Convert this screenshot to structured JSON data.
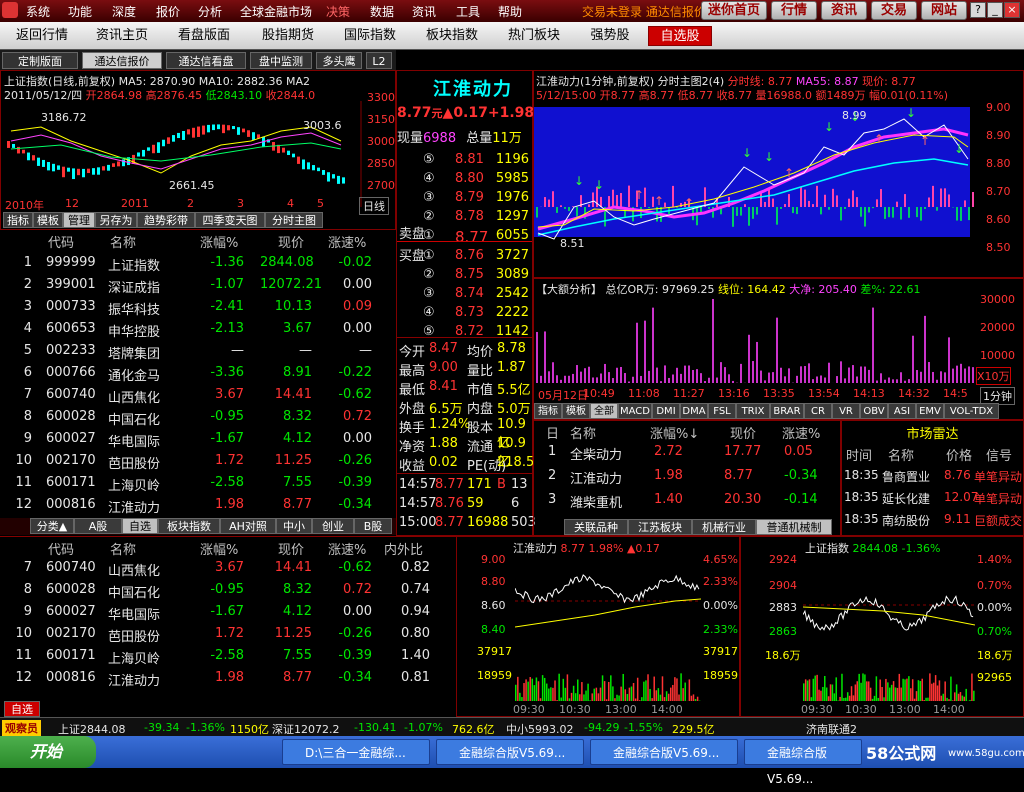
{
  "menubar": {
    "items": [
      "系统",
      "功能",
      "深度",
      "报价",
      "分析",
      "全球金融市场",
      "决策",
      "数据",
      "资讯",
      "工具",
      "帮助"
    ],
    "promo": "交易未登录 通达信报价",
    "buttons": [
      "迷你首页",
      "行情",
      "资讯",
      "交易",
      "网站"
    ]
  },
  "nav": {
    "items": [
      "返回行情",
      "资讯主页",
      "看盘版面",
      "股指期货",
      "国际指数",
      "板块指数",
      "热门板块",
      "强势股",
      "自选股"
    ],
    "active": "自选股"
  },
  "subtabs": [
    "定制版面",
    "通达信报价",
    "通达信看盘",
    "盘中监测",
    "多头鹰",
    "L2"
  ],
  "index_chart": {
    "title": "上证指数(日线,前复权) MA5: 2870.90 MA10: 2882.36 MA2",
    "date_line": "2011/05/12/四",
    "open": "开2864.98",
    "high": "高2876.45",
    "low": "低2843.10",
    "close": "收2844.0",
    "yticks": [
      "3300",
      "3150",
      "3000",
      "2850",
      "2700"
    ],
    "labels": {
      "p1": "3186.72",
      "p2": "3003.6",
      "p3": "2661.45"
    },
    "xlabels": [
      "2010年",
      "12",
      "2011",
      "2",
      "3",
      "4",
      "5"
    ],
    "mode": "日线",
    "tabs": [
      "指标",
      "模板",
      "管理",
      "另存为",
      "趋势彩带",
      "四季变天图",
      "分时主图"
    ]
  },
  "stock_table": {
    "headers": [
      "代码",
      "名称",
      "涨幅%",
      "现价",
      "涨速%"
    ],
    "rows": [
      [
        "1",
        "999999",
        "上证指数",
        "-1.36",
        "2844.08",
        "-0.02"
      ],
      [
        "2",
        "399001",
        "深证成指",
        "-1.07",
        "12072.21",
        "0.00"
      ],
      [
        "3",
        "000733",
        "振华科技",
        "-2.41",
        "10.13",
        "0.09"
      ],
      [
        "4",
        "600653",
        "申华控股",
        "-2.13",
        "3.67",
        "0.00"
      ],
      [
        "5",
        "002233",
        "塔牌集团",
        "—",
        "—",
        "—"
      ],
      [
        "6",
        "000766",
        "通化金马",
        "-3.36",
        "8.91",
        "-0.22"
      ],
      [
        "7",
        "600740",
        "山西焦化",
        "3.67",
        "14.41",
        "-0.62"
      ],
      [
        "8",
        "600028",
        "中国石化",
        "-0.95",
        "8.32",
        "0.72"
      ],
      [
        "9",
        "600027",
        "华电国际",
        "-1.67",
        "4.12",
        "0.00"
      ],
      [
        "10",
        "002170",
        "芭田股份",
        "1.72",
        "11.25",
        "-0.26"
      ],
      [
        "11",
        "600171",
        "上海贝岭",
        "-2.58",
        "7.55",
        "-0.39"
      ],
      [
        "12",
        "000816",
        "江淮动力",
        "1.98",
        "8.77",
        "-0.34"
      ]
    ],
    "tabs": [
      "分类▲",
      "A股",
      "自选",
      "板块指数",
      "AH对照",
      "中小",
      "创业",
      "B股"
    ]
  },
  "quote": {
    "name": "江淮动力",
    "price": "8.77",
    "unit": "元",
    "change": "▲0.17",
    "pct": "+1.98",
    "now_vol_label": "现量",
    "now_vol": "6988",
    "total_label": "总量",
    "total": "11万",
    "sell": [
      [
        "⑤",
        "8.81",
        "1196"
      ],
      [
        "④",
        "8.80",
        "5985"
      ],
      [
        "③",
        "8.79",
        "1976"
      ],
      [
        "②",
        "8.78",
        "1297"
      ],
      [
        "①",
        "8.77",
        "6055"
      ]
    ],
    "sell_label": "卖盘",
    "buy_label": "买盘",
    "buy": [
      [
        "①",
        "8.76",
        "3727"
      ],
      [
        "②",
        "8.75",
        "3089"
      ],
      [
        "③",
        "8.74",
        "2542"
      ],
      [
        "④",
        "8.73",
        "2222"
      ],
      [
        "⑤",
        "8.72",
        "1142"
      ]
    ],
    "stats": [
      [
        "今开",
        "8.47",
        "均价",
        "8.78"
      ],
      [
        "最高",
        "9.00",
        "量比",
        "1.87"
      ],
      [
        "最低",
        "8.41",
        "市值",
        "5.5亿"
      ],
      [
        "外盘",
        "6.5万",
        "内盘",
        "5.0万"
      ],
      [
        "换手",
        "1.24%",
        "股本",
        "10.9亿"
      ],
      [
        "净资",
        "1.88",
        "流通",
        "10.9亿"
      ],
      [
        "收益",
        "0.02",
        "PE(动)",
        "218.5"
      ]
    ],
    "ticks": [
      [
        "14:57",
        "8.77",
        "171",
        "B",
        "13"
      ],
      [
        "14:57",
        "8.76",
        "59",
        "",
        "6"
      ],
      [
        "15:00",
        "8.77",
        "16988",
        "",
        "503"
      ]
    ]
  },
  "intraday": {
    "title": "江淮动力(1分钟,前复权) 分时主图2(4)",
    "ma1": "分时线: 8.77",
    "ma2": "MA55: 8.87",
    "now": "现价: 8.77",
    "line2": "5/12/15:00 开8.77 高8.77 低8.77 收8.77 量16988.0 额1489万 幅0.01(0.11%)",
    "yticks": [
      "9.00",
      "8.90",
      "8.80",
      "8.70",
      "8.60",
      "8.50"
    ],
    "p_hi": "8.99",
    "p_lo": "8.51"
  },
  "fund": {
    "title": "【大额分析】",
    "v1": "总亿OR万: 97969.25",
    "v2": "线位: 164.42",
    "v3": "大净: 205.40",
    "v4": "差%: 22.61",
    "yticks": [
      "30000",
      "20000",
      "10000"
    ],
    "unit": "X10万",
    "xlabels": [
      "05月12日",
      "10:49",
      "11:08",
      "11:27",
      "13:16",
      "13:35",
      "13:54",
      "14:13",
      "14:32",
      "14:5"
    ],
    "period": "1分钟",
    "tabs": [
      "指标",
      "模板",
      "全部",
      "MACD",
      "DMI",
      "DMA",
      "FSL",
      "TRIX",
      "BRAR",
      "CR",
      "VR",
      "OBV",
      "ASI",
      "EMV",
      "VOL-TDX"
    ]
  },
  "sector": {
    "headers": [
      "日",
      "名称",
      "涨幅%↓",
      "现价",
      "涨速%"
    ],
    "rows": [
      [
        "1",
        "全柴动力",
        "2.72",
        "17.77",
        "0.05"
      ],
      [
        "2",
        "江淮动力",
        "1.98",
        "8.77",
        "-0.34"
      ],
      [
        "3",
        "潍柴重机",
        "1.40",
        "20.30",
        "-0.14"
      ]
    ],
    "tabs": [
      "关联品种",
      "江苏板块",
      "机械行业",
      "普通机械制"
    ]
  },
  "radar": {
    "title": "市场雷达",
    "headers": [
      "时间",
      "名称",
      "价格",
      "信号"
    ],
    "rows": [
      [
        "18:35",
        "鲁商置业",
        "8.76",
        "单笔异动"
      ],
      [
        "18:35",
        "延长化建",
        "12.07",
        "单笔异动"
      ],
      [
        "18:35",
        "南纺股份",
        "9.11",
        "巨额成交"
      ]
    ]
  },
  "bottom_table": {
    "headers": [
      "代码",
      "名称",
      "涨幅%",
      "现价",
      "涨速%",
      "内外比"
    ],
    "rows": [
      [
        "7",
        "600740",
        "山西焦化",
        "3.67",
        "14.41",
        "-0.62",
        "0.82"
      ],
      [
        "8",
        "600028",
        "中国石化",
        "-0.95",
        "8.32",
        "0.72",
        "0.74"
      ],
      [
        "9",
        "600027",
        "华电国际",
        "-1.67",
        "4.12",
        "0.00",
        "0.94"
      ],
      [
        "10",
        "002170",
        "芭田股份",
        "1.72",
        "11.25",
        "-0.26",
        "0.80"
      ],
      [
        "11",
        "600171",
        "上海贝岭",
        "-2.58",
        "7.55",
        "-0.39",
        "1.40"
      ],
      [
        "12",
        "000816",
        "江淮动力",
        "1.98",
        "8.77",
        "-0.34",
        "0.81"
      ]
    ],
    "tab": "自选"
  },
  "mini1": {
    "title": "江淮动力",
    "price": "8.77",
    "pct": "1.98%",
    "chg": "▲0.17",
    "yl": [
      "9.00",
      "8.80",
      "8.60",
      "8.40",
      "37917",
      "18959"
    ],
    "yr": [
      "4.65%",
      "2.33%",
      "0.00%",
      "2.33%",
      "37917",
      "18959"
    ],
    "xl": [
      "09:30",
      "10:30",
      "13:00",
      "14:00"
    ]
  },
  "mini2": {
    "title": "上证指数",
    "price": "2844.08",
    "pct": "-1.36%",
    "yl": [
      "2924",
      "2904",
      "2883",
      "2863",
      "18.6万"
    ],
    "yr": [
      "1.40%",
      "0.70%",
      "0.00%",
      "0.70%",
      "18.6万",
      "92965"
    ],
    "xl": [
      "09:30",
      "10:30",
      "13:00",
      "14:00"
    ]
  },
  "status": {
    "label": "观察员",
    "sh": "上证2844.08",
    "sh2": "-39.34",
    "sh3": "-1.36%",
    "sh4": "1150亿",
    "sz": "深证12072.2",
    "sz2": "-130.41",
    "sz3": "-1.07%",
    "sz4": "762.6亿",
    "zx": "中小5993.02",
    "zx2": "-94.29",
    "zx3": "-1.55%",
    "zx4": "229.5亿",
    "conn": "济南联通2"
  },
  "taskbar": {
    "start": "开始",
    "tasks": [
      "D:\\三合一金融综...",
      "金融综合版V5.69...",
      "金融综合版V5.69...",
      "金融综合版V5.69..."
    ],
    "brand": "58公式网",
    "url": "www.58gu.com"
  },
  "colors": {
    "up": "#ff3333",
    "down": "#00e600",
    "accent": "#c00000"
  }
}
